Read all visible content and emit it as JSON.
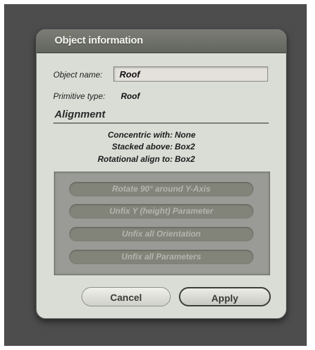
{
  "dialog": {
    "title": "Object information"
  },
  "object": {
    "name_label": "Object name:",
    "name_value": "Roof",
    "primitive_label": "Primitive type:",
    "primitive_value": "Roof"
  },
  "alignment": {
    "section_title": "Alignment",
    "concentric_label": "Concentric with:",
    "concentric_value": "None",
    "stacked_label": "Stacked above:",
    "stacked_value": "Box2",
    "rotational_label": "Rotational align to:",
    "rotational_value": "Box2"
  },
  "panel_buttons": [
    {
      "label": "Rotate 90° around Y-Axis",
      "enabled": false
    },
    {
      "label": "Unfix Y (height) Parameter",
      "enabled": false
    },
    {
      "label": "Unfix all Orientation",
      "enabled": false
    },
    {
      "label": "Unfix all Parameters",
      "enabled": false
    }
  ],
  "footer": {
    "cancel_label": "Cancel",
    "apply_label": "Apply"
  },
  "colors": {
    "backdrop": "#4d4d4d",
    "dialog_bg": "#d9ddd6",
    "titlebar": "#6e716a",
    "disabled_button": "#828379"
  }
}
